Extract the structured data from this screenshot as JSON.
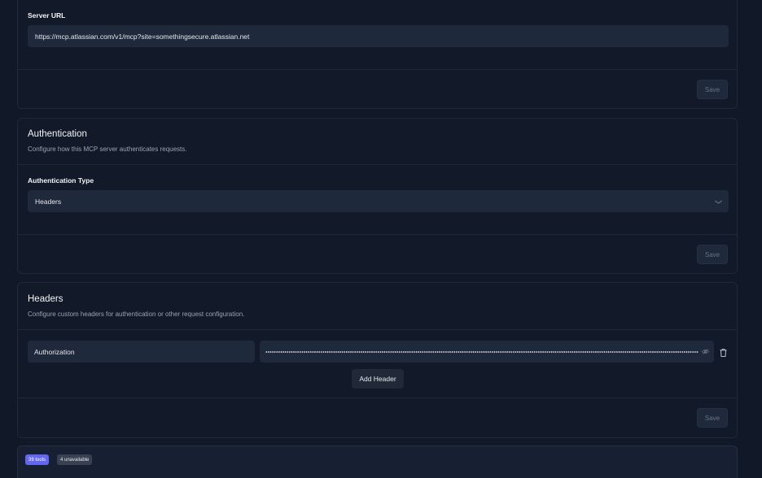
{
  "server_url": {
    "label": "Server URL",
    "value": "https://mcp.atlassian.com/v1/mcp?site=somethingsecure.atlassian.net",
    "save_label": "Save"
  },
  "authentication": {
    "title": "Authentication",
    "description": "Configure how this MCP server authenticates requests.",
    "type_label": "Authentication Type",
    "type_value": "Headers",
    "save_label": "Save"
  },
  "headers": {
    "title": "Headers",
    "description": "Configure custom headers for authentication or other request configuration.",
    "rows": [
      {
        "key": "Authorization"
      }
    ],
    "add_label": "Add Header",
    "save_label": "Save"
  },
  "tools": {
    "count_badge": "39 tools",
    "unavailable_badge": "4 unavailable"
  },
  "colors": {
    "background": "#111827",
    "card": "#121a29",
    "input": "#1e293b",
    "accent": "#6366f1"
  },
  "icons": [
    "eye-icon",
    "trash-icon",
    "chevron-down-icon",
    "menu-icon"
  ]
}
